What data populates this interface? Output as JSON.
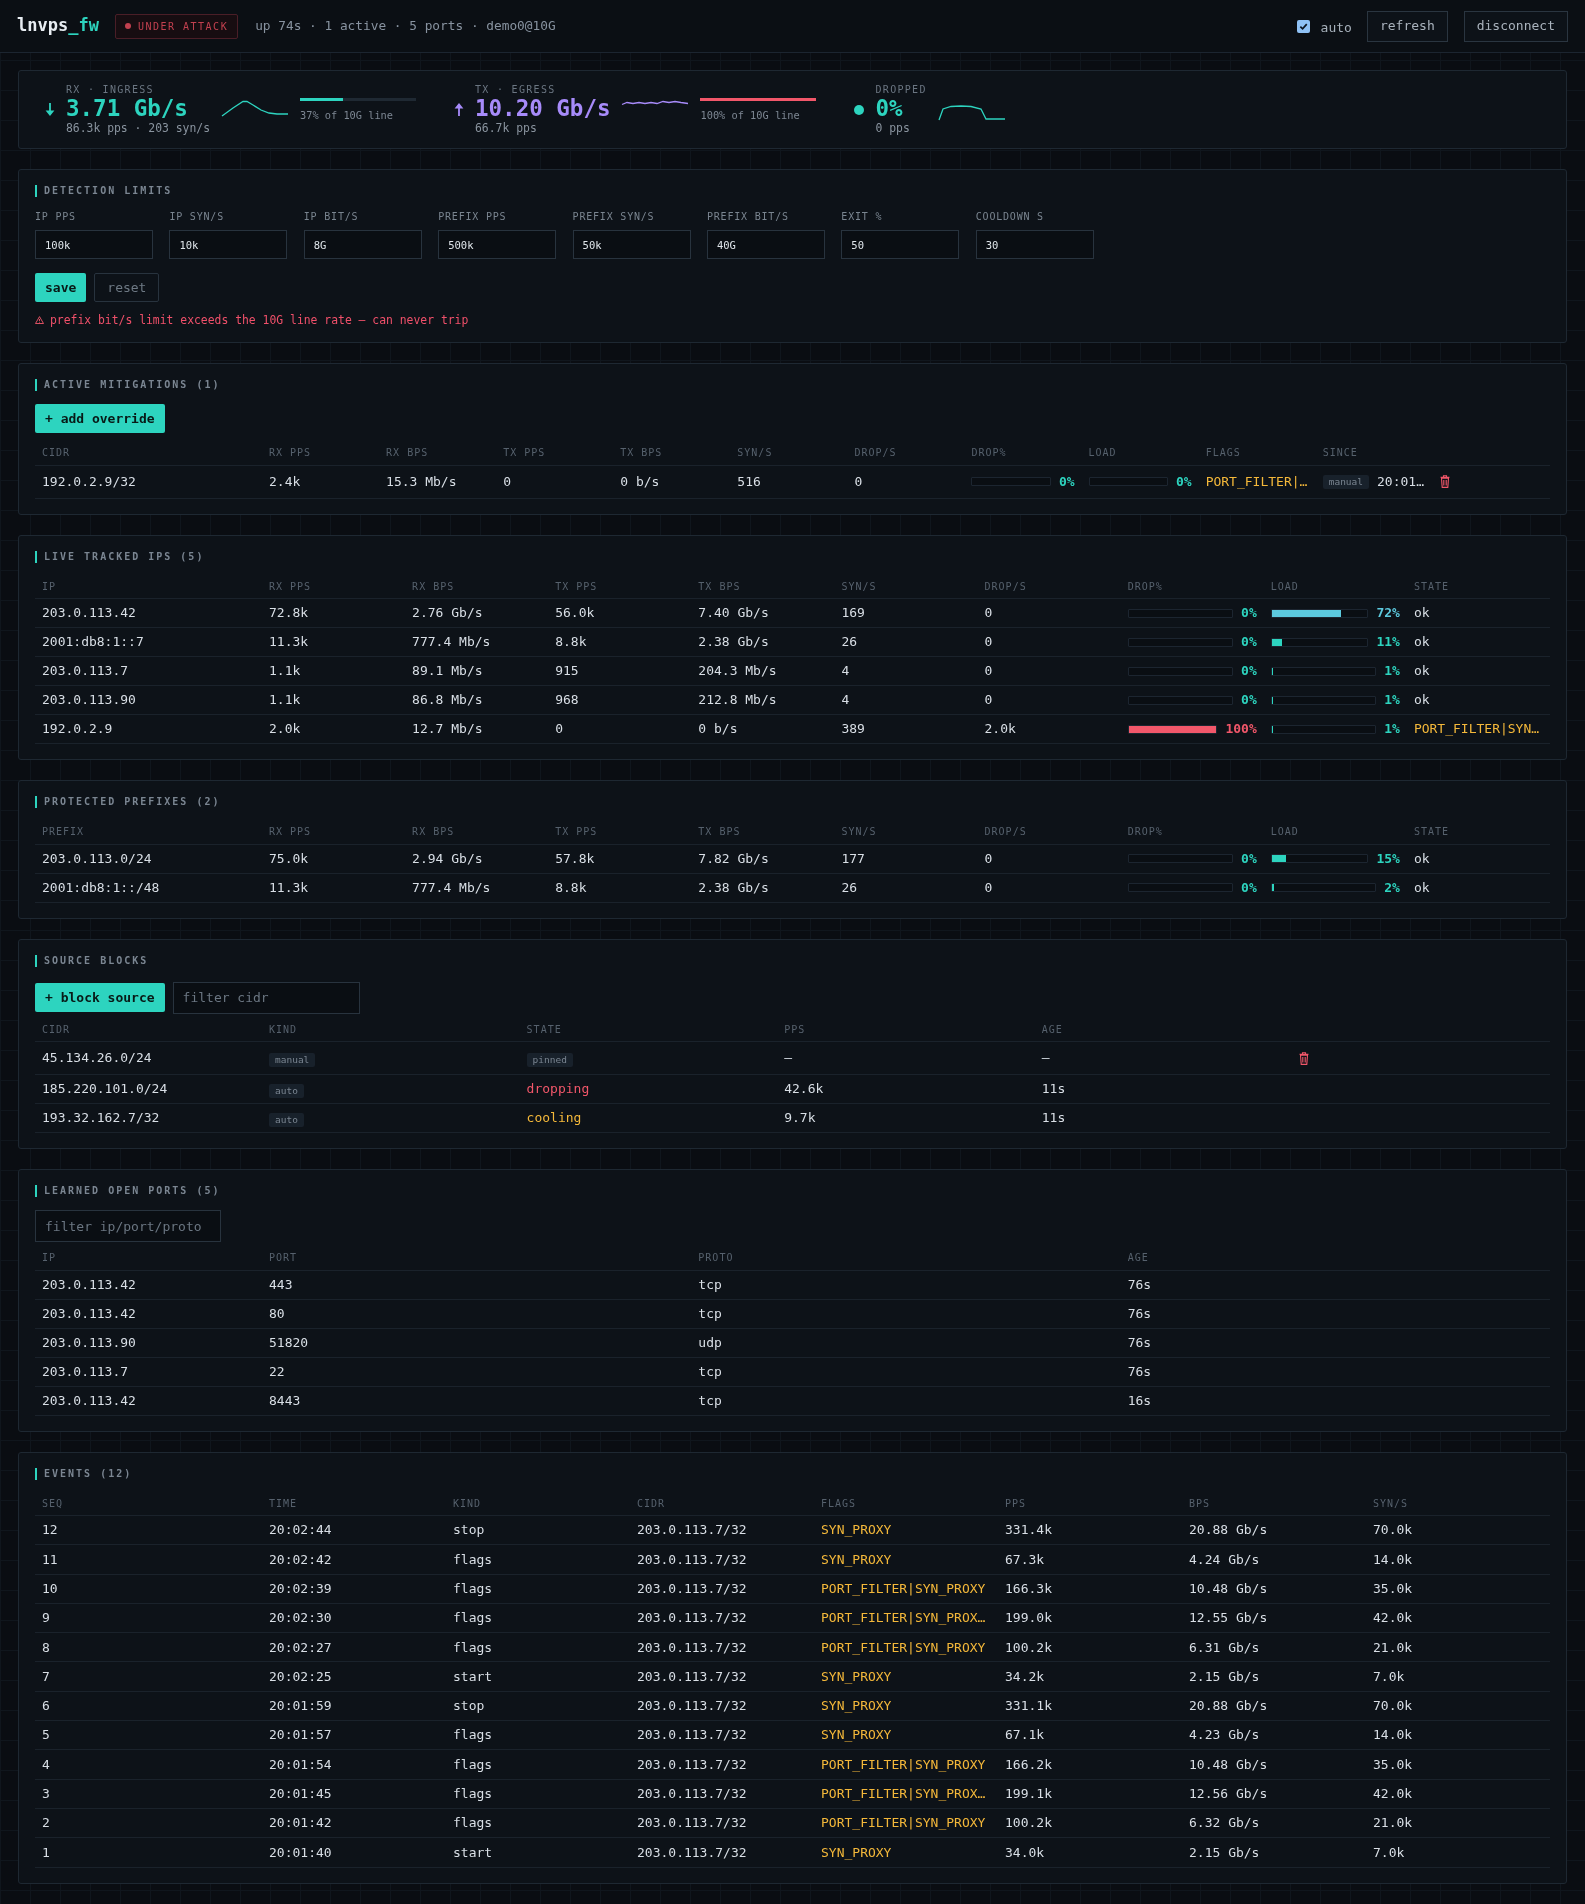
{
  "header": {
    "brand": {
      "name": "lnvps",
      "accent": "_fw"
    },
    "status_badge": {
      "label": "UNDER ATTACK",
      "alert": true
    },
    "summary": "up 74s · 1 active · 5 ports · demo0@10G",
    "auto_refresh": {
      "label": "auto",
      "checked": true
    },
    "buttons": [
      "refresh",
      "disconnect"
    ]
  },
  "traffic": [
    {
      "kind": "in",
      "label": "RX · INGRESS",
      "value": "3.71 Gb/s",
      "detail": "86.3k pps · 203 syn/s",
      "color": "#2dd4bf",
      "line": {
        "level": 0.37,
        "text": "37% of 10G line"
      }
    },
    {
      "kind": "out",
      "label": "TX · EGRESS",
      "value": "10.20 Gb/s",
      "detail": "66.7k pps",
      "color": "#a78bfa",
      "line": {
        "level": 1,
        "text": "100% of 10G line"
      }
    },
    {
      "kind": "drop",
      "label": "DROPPED",
      "value": "0%",
      "detail": "0 pps",
      "color": "#2dd4bf"
    }
  ],
  "detection_limits": {
    "title": "DETECTION LIMITS",
    "fields": [
      {
        "label": "IP PPS",
        "value": "100k"
      },
      {
        "label": "IP SYN/S",
        "value": "10k"
      },
      {
        "label": "IP BIT/S",
        "value": "8G"
      },
      {
        "label": "PREFIX PPS",
        "value": "500k"
      },
      {
        "label": "PREFIX SYN/S",
        "value": "50k"
      },
      {
        "label": "PREFIX BIT/S",
        "value": "40G"
      },
      {
        "label": "EXIT %",
        "value": "50"
      },
      {
        "label": "COOLDOWN S",
        "value": "30"
      }
    ],
    "buttons": [
      {
        "label": "save",
        "kind": "primary"
      },
      {
        "label": "reset",
        "kind": "secondary"
      }
    ],
    "warning": "prefix bit/s limit exceeds the 10G line rate — can never trip"
  },
  "mitigations": {
    "title": "ACTIVE MITIGATIONS (1)",
    "add_button": "+ add override",
    "columns": [
      "CIDR",
      "RX PPS",
      "RX BPS",
      "TX PPS",
      "TX BPS",
      "SYN/S",
      "DROP/S",
      "DROP%",
      "LOAD",
      "FLAGS",
      "SINCE"
    ],
    "rows": [
      {
        "cidr": "192.0.2.9/32",
        "rx_pps": "2.4k",
        "rx_bps": "15.3 Mb/s",
        "tx_pps": "0",
        "tx_bps": "0 b/s",
        "syn_s": "516",
        "drop_s": "0",
        "drop_pct": {
          "level": 0,
          "text": "0%"
        },
        "load": {
          "level": 0,
          "text": "0%"
        },
        "flags": "PORT_FILTER|…",
        "since": {
          "tag": "manual",
          "time": "20:01…"
        },
        "deletable": true
      }
    ]
  },
  "tracked_ips": {
    "title": "LIVE TRACKED IPS (5)",
    "columns": [
      "IP",
      "RX PPS",
      "RX BPS",
      "TX PPS",
      "TX BPS",
      "SYN/S",
      "DROP/S",
      "DROP%",
      "LOAD",
      "STATE"
    ],
    "rows": [
      {
        "ip": "203.0.113.42",
        "rx_pps": "72.8k",
        "rx_bps": "2.76 Gb/s",
        "tx_pps": "56.0k",
        "tx_bps": "7.40 Gb/s",
        "syn_s": "169",
        "drop_s": "0",
        "drop_pct": {
          "level": 0,
          "text": "0%"
        },
        "load": {
          "level": 0.72,
          "text": "72%"
        },
        "state": {
          "kind": "ok",
          "text": "ok"
        }
      },
      {
        "ip": "2001:db8:1::7",
        "rx_pps": "11.3k",
        "rx_bps": "777.4 Mb/s",
        "tx_pps": "8.8k",
        "tx_bps": "2.38 Gb/s",
        "syn_s": "26",
        "drop_s": "0",
        "drop_pct": {
          "level": 0,
          "text": "0%"
        },
        "load": {
          "level": 0.11,
          "text": "11%"
        },
        "state": {
          "kind": "ok",
          "text": "ok"
        }
      },
      {
        "ip": "203.0.113.7",
        "rx_pps": "1.1k",
        "rx_bps": "89.1 Mb/s",
        "tx_pps": "915",
        "tx_bps": "204.3 Mb/s",
        "syn_s": "4",
        "drop_s": "0",
        "drop_pct": {
          "level": 0,
          "text": "0%"
        },
        "load": {
          "level": 0.01,
          "text": "1%"
        },
        "state": {
          "kind": "ok",
          "text": "ok"
        }
      },
      {
        "ip": "203.0.113.90",
        "rx_pps": "1.1k",
        "rx_bps": "86.8 Mb/s",
        "tx_pps": "968",
        "tx_bps": "212.8 Mb/s",
        "syn_s": "4",
        "drop_s": "0",
        "drop_pct": {
          "level": 0,
          "text": "0%"
        },
        "load": {
          "level": 0.01,
          "text": "1%"
        },
        "state": {
          "kind": "ok",
          "text": "ok"
        }
      },
      {
        "ip": "192.0.2.9",
        "rx_pps": "2.0k",
        "rx_bps": "12.7 Mb/s",
        "tx_pps": "0",
        "tx_bps": "0 b/s",
        "syn_s": "389",
        "drop_s": "2.0k",
        "drop_pct": {
          "level": 1,
          "text": "100%"
        },
        "load": {
          "level": 0.01,
          "text": "1%"
        },
        "state": {
          "kind": "flags",
          "text": "PORT_FILTER|SYN…"
        }
      }
    ]
  },
  "protected_prefixes": {
    "title": "PROTECTED PREFIXES (2)",
    "columns": [
      "PREFIX",
      "RX PPS",
      "RX BPS",
      "TX PPS",
      "TX BPS",
      "SYN/S",
      "DROP/S",
      "DROP%",
      "LOAD",
      "STATE"
    ],
    "rows": [
      {
        "prefix": "203.0.113.0/24",
        "rx_pps": "75.0k",
        "rx_bps": "2.94 Gb/s",
        "tx_pps": "57.8k",
        "tx_bps": "7.82 Gb/s",
        "syn_s": "177",
        "drop_s": "0",
        "drop_pct": {
          "level": 0,
          "text": "0%"
        },
        "load": {
          "level": 0.15,
          "text": "15%"
        },
        "state": {
          "kind": "ok",
          "text": "ok"
        }
      },
      {
        "prefix": "2001:db8:1::/48",
        "rx_pps": "11.3k",
        "rx_bps": "777.4 Mb/s",
        "tx_pps": "8.8k",
        "tx_bps": "2.38 Gb/s",
        "syn_s": "26",
        "drop_s": "0",
        "drop_pct": {
          "level": 0,
          "text": "0%"
        },
        "load": {
          "level": 0.02,
          "text": "2%"
        },
        "state": {
          "kind": "ok",
          "text": "ok"
        }
      }
    ]
  },
  "source_blocks": {
    "title": "SOURCE BLOCKS",
    "add_button": "+ block source",
    "filter": {
      "placeholder": "filter cidr"
    },
    "columns": [
      "CIDR",
      "KIND",
      "STATE",
      "PPS",
      "AGE"
    ],
    "rows": [
      {
        "cidr": "45.134.26.0/24",
        "origin": "manual",
        "state": {
          "kind": "tag",
          "text": "pinned"
        },
        "pps": "—",
        "age": "—",
        "deletable": true
      },
      {
        "cidr": "185.220.101.0/24",
        "origin": "auto",
        "state": {
          "kind": "alert",
          "text": "dropping"
        },
        "pps": "42.6k",
        "age": "11s",
        "deletable": false
      },
      {
        "cidr": "193.32.162.7/32",
        "origin": "auto",
        "state": {
          "kind": "warn",
          "text": "cooling"
        },
        "pps": "9.7k",
        "age": "11s",
        "deletable": false
      }
    ]
  },
  "open_ports": {
    "title": "LEARNED OPEN PORTS (5)",
    "filter": {
      "placeholder": "filter ip/port/proto"
    },
    "columns": [
      "IP",
      "PORT",
      "PROTO",
      "AGE"
    ],
    "rows": [
      {
        "ip": "203.0.113.42",
        "port": "443",
        "proto": "tcp",
        "age": "76s"
      },
      {
        "ip": "203.0.113.42",
        "port": "80",
        "proto": "tcp",
        "age": "76s"
      },
      {
        "ip": "203.0.113.90",
        "port": "51820",
        "proto": "udp",
        "age": "76s"
      },
      {
        "ip": "203.0.113.7",
        "port": "22",
        "proto": "tcp",
        "age": "76s"
      },
      {
        "ip": "203.0.113.42",
        "port": "8443",
        "proto": "tcp",
        "age": "16s"
      }
    ]
  },
  "events": {
    "title": "EVENTS (12)",
    "columns": [
      "SEQ",
      "TIME",
      "KIND",
      "CIDR",
      "FLAGS",
      "PPS",
      "BPS",
      "SYN/S"
    ],
    "rows": [
      {
        "seq": "12",
        "time": "20:02:44",
        "event": "stop",
        "cidr": "203.0.113.7/32",
        "flags": "SYN_PROXY",
        "pps": "331.4k",
        "bps": "20.88 Gb/s",
        "syn_s": "70.0k"
      },
      {
        "seq": "11",
        "time": "20:02:42",
        "event": "flags",
        "cidr": "203.0.113.7/32",
        "flags": "SYN_PROXY",
        "pps": "67.3k",
        "bps": "4.24 Gb/s",
        "syn_s": "14.0k"
      },
      {
        "seq": "10",
        "time": "20:02:39",
        "event": "flags",
        "cidr": "203.0.113.7/32",
        "flags": "PORT_FILTER|SYN_PROXY",
        "pps": "166.3k",
        "bps": "10.48 Gb/s",
        "syn_s": "35.0k"
      },
      {
        "seq": "9",
        "time": "20:02:30",
        "event": "flags",
        "cidr": "203.0.113.7/32",
        "flags": "PORT_FILTER|SYN_PROX…",
        "pps": "199.0k",
        "bps": "12.55 Gb/s",
        "syn_s": "42.0k"
      },
      {
        "seq": "8",
        "time": "20:02:27",
        "event": "flags",
        "cidr": "203.0.113.7/32",
        "flags": "PORT_FILTER|SYN_PROXY",
        "pps": "100.2k",
        "bps": "6.31 Gb/s",
        "syn_s": "21.0k"
      },
      {
        "seq": "7",
        "time": "20:02:25",
        "event": "start",
        "cidr": "203.0.113.7/32",
        "flags": "SYN_PROXY",
        "pps": "34.2k",
        "bps": "2.15 Gb/s",
        "syn_s": "7.0k"
      },
      {
        "seq": "6",
        "time": "20:01:59",
        "event": "stop",
        "cidr": "203.0.113.7/32",
        "flags": "SYN_PROXY",
        "pps": "331.1k",
        "bps": "20.88 Gb/s",
        "syn_s": "70.0k"
      },
      {
        "seq": "5",
        "time": "20:01:57",
        "event": "flags",
        "cidr": "203.0.113.7/32",
        "flags": "SYN_PROXY",
        "pps": "67.1k",
        "bps": "4.23 Gb/s",
        "syn_s": "14.0k"
      },
      {
        "seq": "4",
        "time": "20:01:54",
        "event": "flags",
        "cidr": "203.0.113.7/32",
        "flags": "PORT_FILTER|SYN_PROXY",
        "pps": "166.2k",
        "bps": "10.48 Gb/s",
        "syn_s": "35.0k"
      },
      {
        "seq": "3",
        "time": "20:01:45",
        "event": "flags",
        "cidr": "203.0.113.7/32",
        "flags": "PORT_FILTER|SYN_PROX…",
        "pps": "199.1k",
        "bps": "12.56 Gb/s",
        "syn_s": "42.0k"
      },
      {
        "seq": "2",
        "time": "20:01:42",
        "event": "flags",
        "cidr": "203.0.113.7/32",
        "flags": "PORT_FILTER|SYN_PROXY",
        "pps": "100.2k",
        "bps": "6.32 Gb/s",
        "syn_s": "21.0k"
      },
      {
        "seq": "1",
        "time": "20:01:40",
        "event": "start",
        "cidr": "203.0.113.7/32",
        "flags": "SYN_PROXY",
        "pps": "34.0k",
        "bps": "2.15 Gb/s",
        "syn_s": "7.0k"
      }
    ]
  }
}
